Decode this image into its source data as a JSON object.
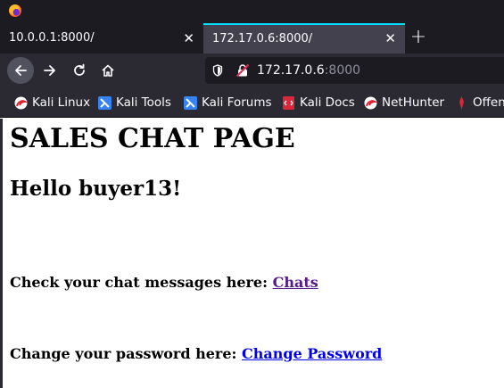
{
  "browser": {
    "tabs": [
      {
        "title": "10.0.0.1:8000/",
        "active": false
      },
      {
        "title": "172.17.0.6:8000/",
        "active": true
      }
    ],
    "url": {
      "host": "172.17.0.6",
      "port": ":8000"
    },
    "icons": {
      "logo": "firefox-logo-icon",
      "back": "arrow-left-icon",
      "forward": "arrow-right-icon",
      "reload": "reload-icon",
      "home": "home-icon",
      "shield": "shield-icon",
      "insecure": "insecure-lock-icon",
      "new_tab": "plus-icon",
      "close": "close-icon"
    },
    "bookmarks": [
      {
        "label": "Kali Linux",
        "icon": "kali-dragon-icon"
      },
      {
        "label": "Kali Tools",
        "icon": "kali-tools-icon"
      },
      {
        "label": "Kali Forums",
        "icon": "kali-forums-icon"
      },
      {
        "label": "Kali Docs",
        "icon": "kali-docs-icon"
      },
      {
        "label": "NetHunter",
        "icon": "nethunter-icon"
      },
      {
        "label": "Offen",
        "icon": "offsec-icon"
      }
    ]
  },
  "page": {
    "heading": "SALES CHAT PAGE",
    "greeting": "Hello buyer13!",
    "chats_prompt": "Check your chat messages here:",
    "chats_link": "Chats",
    "password_prompt": "Change your password here:",
    "password_link": "Change Password"
  },
  "colors": {
    "link_visited": "#551a8b",
    "link_unvisited": "#0000ee",
    "tab_accent": "#00ddff"
  }
}
